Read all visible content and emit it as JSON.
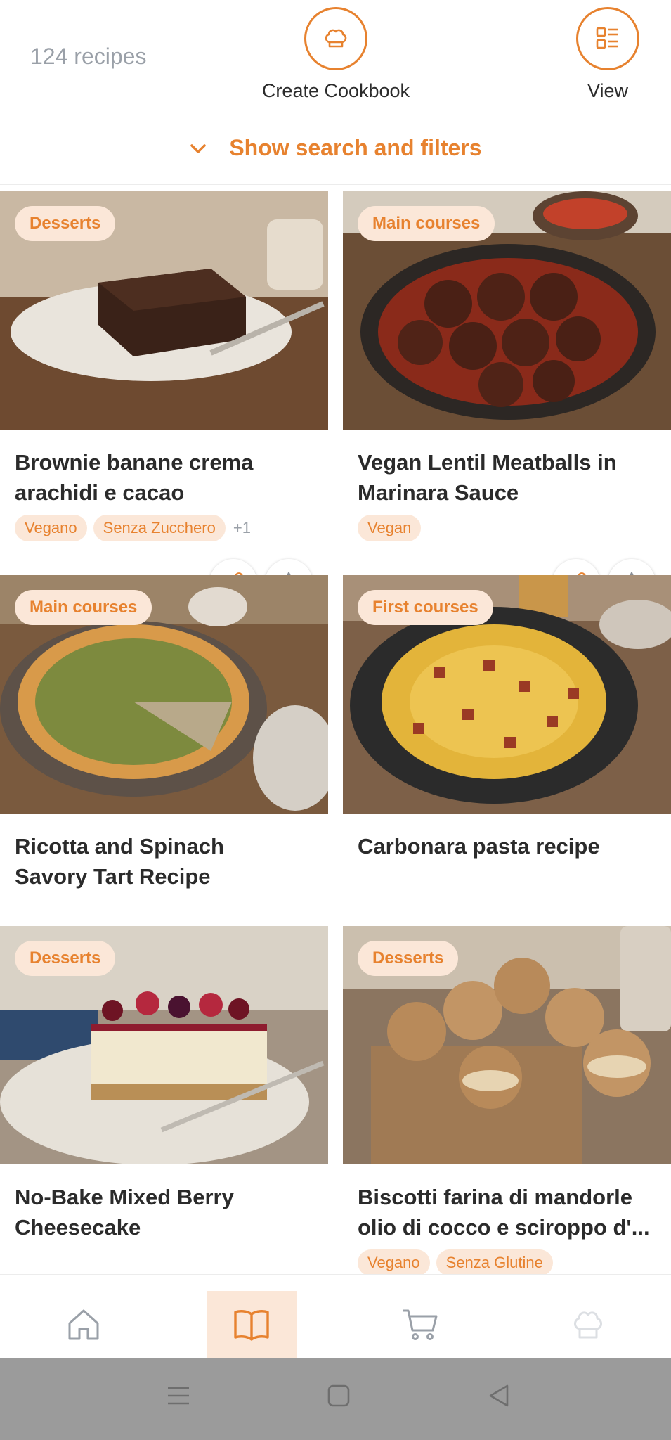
{
  "header": {
    "recipe_count": "124 recipes",
    "create_cookbook_label": "Create Cookbook",
    "view_label": "View",
    "filters_toggle": "Show search and filters"
  },
  "colors": {
    "accent": "#e7822f",
    "badge_bg": "#fbe7d8",
    "muted_text": "#9aa0a8"
  },
  "recipes": [
    {
      "category": "Desserts",
      "title": "Brownie banane crema\narachidi e cacao",
      "tags": [
        "Vegano",
        "Senza Zucchero"
      ],
      "more_tags": "+1",
      "image": "brownie"
    },
    {
      "category": "Main courses",
      "title": "Vegan Lentil Meatballs in\nMarinara Sauce",
      "tags": [
        "Vegan"
      ],
      "more_tags": "",
      "image": "meatballs"
    },
    {
      "category": "Main courses",
      "title": "Ricotta and Spinach\nSavory Tart Recipe",
      "tags": [],
      "more_tags": "",
      "image": "tart"
    },
    {
      "category": "First courses",
      "title": "Carbonara pasta recipe",
      "tags": [],
      "more_tags": "",
      "image": "carbonara"
    },
    {
      "category": "Desserts",
      "title": "No-Bake Mixed Berry\nCheesecake",
      "tags": [],
      "more_tags": "",
      "image": "cheesecake"
    },
    {
      "category": "Desserts",
      "title": "Biscotti farina di mandorle\nolio di cocco e sciroppo d'...",
      "tags": [
        "Vegano",
        "Senza Glutine"
      ],
      "more_tags": "",
      "image": "cookies"
    }
  ],
  "bottom_nav": {
    "items": [
      {
        "name": "home",
        "icon": "home-icon",
        "active": false
      },
      {
        "name": "recipes",
        "icon": "book-icon",
        "active": true
      },
      {
        "name": "shopping",
        "icon": "cart-icon",
        "active": false
      },
      {
        "name": "cooking",
        "icon": "chef-hat-icon",
        "active": false
      }
    ]
  },
  "system_nav": {
    "items": [
      "menu-icon",
      "home-square-icon",
      "back-icon"
    ]
  }
}
